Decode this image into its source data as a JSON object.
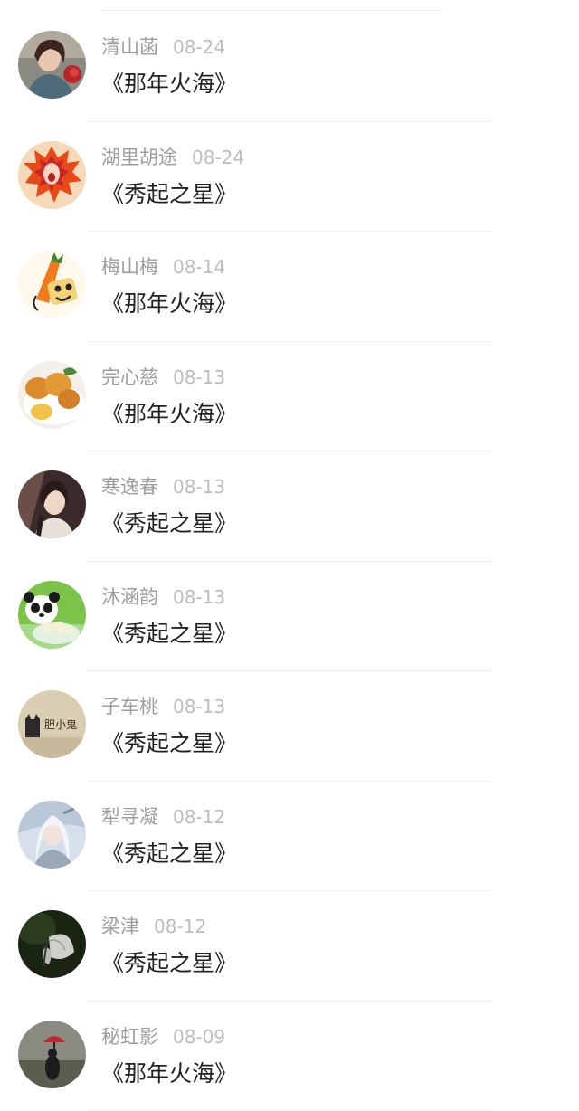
{
  "comments": [
    {
      "user": "清山菡",
      "date": "08-24",
      "title": "《那年火海》",
      "avatar": "avatar-woman-red-flower"
    },
    {
      "user": "湖里胡途",
      "date": "08-24",
      "title": "《秀起之星》",
      "avatar": "avatar-fire-cartoon"
    },
    {
      "user": "梅山梅",
      "date": "08-14",
      "title": "《那年火海》",
      "avatar": "avatar-carrot-cartoon"
    },
    {
      "user": "完心慈",
      "date": "08-13",
      "title": "《那年火海》",
      "avatar": "avatar-fried-food"
    },
    {
      "user": "寒逸春",
      "date": "08-13",
      "title": "《秀起之星》",
      "avatar": "avatar-girl-portrait"
    },
    {
      "user": "沐涵韵",
      "date": "08-13",
      "title": "《秀起之星》",
      "avatar": "avatar-panda"
    },
    {
      "user": "子车桃",
      "date": "08-13",
      "title": "《秀起之星》",
      "avatar": "avatar-cat-text"
    },
    {
      "user": "犁寻凝",
      "date": "08-12",
      "title": "《秀起之星》",
      "avatar": "avatar-white-hair-character"
    },
    {
      "user": "梁津",
      "date": "08-12",
      "title": "《秀起之星》",
      "avatar": "avatar-butterfly"
    },
    {
      "user": "秘虹影",
      "date": "08-09",
      "title": "《那年火海》",
      "avatar": "avatar-red-umbrella"
    }
  ],
  "avatar_text": {
    "cat_badge": "胆小鬼"
  }
}
